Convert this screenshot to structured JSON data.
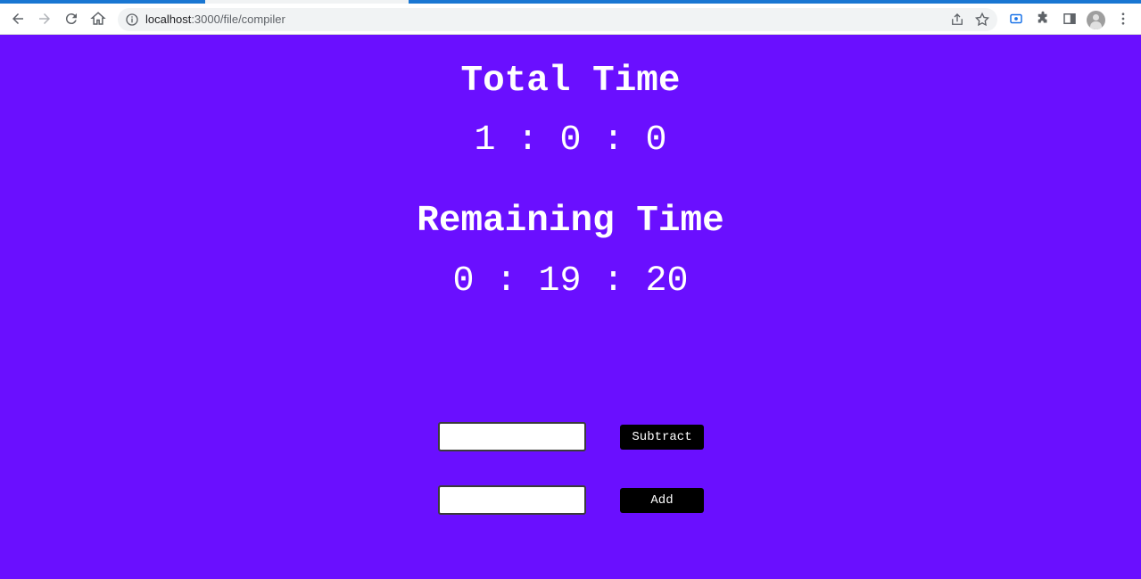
{
  "browser": {
    "url_host": "localhost",
    "url_rest": ":3000/file/compiler",
    "icons": {
      "back": "arrow-left-icon",
      "forward": "arrow-right-icon",
      "reload": "reload-icon",
      "home": "home-icon",
      "info": "info-icon",
      "share": "share-icon",
      "bookmark": "star-icon",
      "cast": "media-icon",
      "extensions": "puzzle-icon",
      "sidepanel": "side-panel-icon",
      "profile": "avatar-icon",
      "menu": "kebab-menu-icon"
    }
  },
  "timer": {
    "total_label": "Total Time",
    "total_value": "1 : 0 : 0",
    "remaining_label": "Remaining Time",
    "remaining_value": "0 : 19 : 20"
  },
  "controls": {
    "subtract_input_value": "",
    "subtract_label": "Subtract",
    "add_input_value": "",
    "add_label": "Add"
  },
  "colors": {
    "background": "#6a0fff",
    "text": "#ffffff",
    "button_bg": "#000000"
  }
}
